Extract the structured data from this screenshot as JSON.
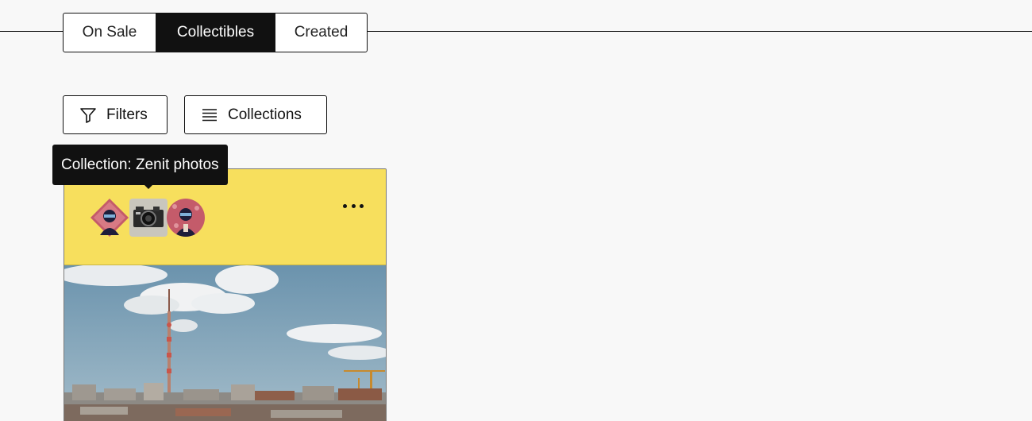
{
  "tabs": {
    "on_sale": "On Sale",
    "collectibles": "Collectibles",
    "created": "Created"
  },
  "toolbar": {
    "filters_label": "Filters",
    "collections_label": "Collections"
  },
  "tooltip": {
    "text": "Collection: Zenit photos"
  },
  "card": {
    "avatars": [
      "profile-avatar",
      "camera-avatar",
      "profile-avatar"
    ]
  },
  "colors": {
    "card_header": "#f7df5d",
    "active_tab": "#111111",
    "page_background": "#f8f8f8"
  }
}
